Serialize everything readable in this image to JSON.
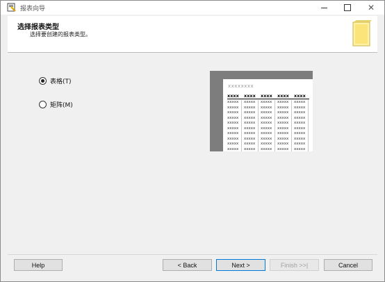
{
  "window": {
    "title": "报表向导",
    "icon": "wizard-icon"
  },
  "header": {
    "title": "选择报表类型",
    "subtitle": "选择要创建的报表类型。",
    "icon": "report-document-icon"
  },
  "options": [
    {
      "label": "表格(T)",
      "selected": true
    },
    {
      "label": "矩阵(M)",
      "selected": false
    }
  ],
  "preview": {
    "title": "xxxxxxxx",
    "header_cells": [
      "xxxx",
      "xxxx",
      "xxxx",
      "xxxx",
      "xxxx"
    ],
    "row_cell": "xxxxx",
    "row_count": 11
  },
  "buttons": {
    "help": "Help",
    "back": "< Back",
    "next": "Next >",
    "finish": "Finish >>|",
    "cancel": "Cancel"
  }
}
